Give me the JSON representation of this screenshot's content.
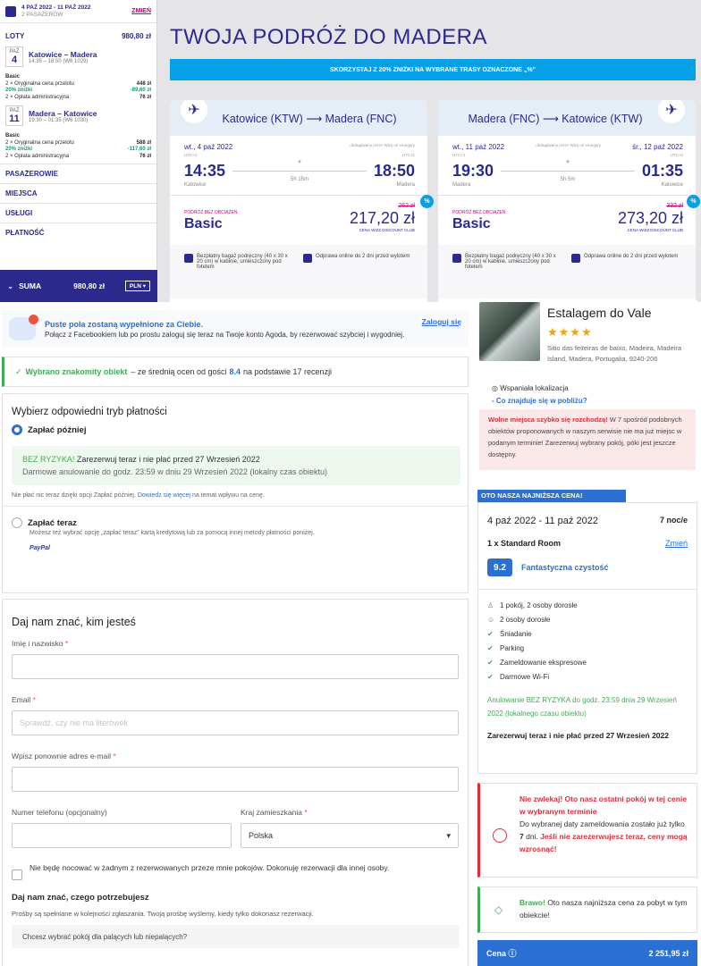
{
  "wizz": {
    "sidebar": {
      "dates": "4 PAŹ 2022 - 11 PAŹ 2022",
      "passengers": "2 PASAŻERÓW",
      "change": "ZMIEŃ",
      "flights_label": "LOTY",
      "flights_total": "980,80 zł",
      "flight1": {
        "month": "PAŹ",
        "day": "4",
        "route": "Katowice – Madera",
        "time": "14:35 – 18:50 (W6 1029)"
      },
      "fare1": {
        "name": "Basic",
        "l1": "2 × Oryginalna cena przelotu",
        "v1": "448 zł",
        "l2": "20% zniżki",
        "v2": "-89,60 zł",
        "l3": "2 × Opłata administracyjna",
        "v3": "76 zł"
      },
      "flight2": {
        "month": "PAŹ",
        "day": "11",
        "route": "Madera – Katowice",
        "time": "19:30 – 01:35 (W6 1030)"
      },
      "fare2": {
        "name": "Basic",
        "l1": "2 × Oryginalna cena przelotu",
        "v1": "588 zł",
        "l2": "20% zniżki",
        "v2": "-117,60 zł",
        "l3": "2 × Opłata administracyjna",
        "v3": "76 zł"
      },
      "sections": [
        "PASAŻEROWIE",
        "MIEJSCA",
        "USŁUGI",
        "PŁATNOŚĆ"
      ],
      "suma_label": "SUMA",
      "suma_value": "980,80 zł",
      "currency": "PLN"
    },
    "title": "TWOJA PODRÓŻ DO MADERA",
    "banner": "SKORZYSTAJ Z 20% ZNIŻKI NA WYBRANE TRASY OZNACZONE „%”",
    "out": {
      "route": "Katowice (KTW) ⟶ Madera (FNC)",
      "date": "wt., 4 paź 2022",
      "operator": "obsługiwany przez Wizz Air Hungary",
      "utc_dep": "UTC+2",
      "utc_arr": "UTC+1",
      "dep": "14:35",
      "arr": "18:50",
      "dur": "5h 15m",
      "from": "Katowice",
      "to": "Madera",
      "fare_label": "PODRÓŻ BEZ OBCIĄŻEŃ",
      "fare": "Basic",
      "old": "262 zł",
      "price": "217,20 zł",
      "club": "CENA WIZZ DISCOUNT CLUB",
      "f1": "Bezpłatny bagaż podręczny (40 x 30 x 20 cm) w kabinie, umieszczony pod fotelem",
      "f2": "Odprawa online do 2 dni przed wylotem"
    },
    "ret": {
      "route": "Madera (FNC) ⟶ Katowice (KTW)",
      "date": "wt., 11 paź 2022",
      "operator": "obsługiwany przez Wizz Air Hungary",
      "date2": "śr., 12 paź 2022",
      "utc_dep": "UTC+1",
      "utc_arr": "UTC+2",
      "dep": "19:30",
      "arr": "01:35",
      "dur": "5h 5m",
      "from": "Madera",
      "to": "Katowice",
      "fare_label": "PODRÓŻ BEZ OBCIĄŻEŃ",
      "fare": "Basic",
      "old": "332 zł",
      "price": "273,20 zł",
      "club": "CENA WIZZ DISCOUNT CLUB",
      "f1": "Bezpłatny bagaż podręczny (40 x 30 x 20 cm) w kabinie, umieszczony pod fotelem",
      "f2": "Odprawa online do 2 dni przed wylotem"
    },
    "pct": "%"
  },
  "agoda": {
    "fb": {
      "title": "Puste pola zostaną wypełnione za Ciebie.",
      "sub": "Połącz z Facebookiem lub po prostu zaloguj się teraz na Twoje konto Agoda, by rezerwować szybciej i wygodniej.",
      "login": "Zaloguj się"
    },
    "ok": {
      "pre": "✓",
      "bold": "Wybrano znakomity obiekt",
      "mid": "– ze średnią ocen od gości",
      "score": "8.4",
      "post": "na podstawie 17 recenzji"
    },
    "pay": {
      "title": "Wybierz odpowiedni tryb płatności",
      "later": "Zapłać później",
      "br1g": "BEZ RYZYKA!",
      "br1": "Zarezerwuj teraz i nie płać przed 27 Wrzesień 2022",
      "br2": "Darmowe anulowanie do godz. 23:59 w dniu 29 Wrzesień 2022 (lokalny czas obiektu)",
      "note1": "Nie płać nic teraz dzięki opcji Zapłać później.",
      "note_link": "Dowiedz się więcej",
      "note2": "na temat wpływu na cenę.",
      "now": "Zapłać teraz",
      "now_sub": "Możesz też wybrać opcję „zapłać teraz” kartą kredytową lub za pomocą innej metody płatności poniżej.",
      "paypal": "PayPal"
    },
    "who": {
      "title": "Daj nam znać, kim jesteś",
      "name": "Imię i nazwisko",
      "email": "Email",
      "email_ph": "Sprawdź, czy nie ma literówek",
      "email2": "Wpisz ponownie adres e-mail",
      "phone": "Numer telefonu (opcjonalny)",
      "country": "Kraj zamieszkania",
      "country_val": "Polska",
      "req": "*",
      "notstay": "Nie będę nocować w żadnym z rezerwowanych przeze mnie pokojów. Dokonuję rezerwacji dla innej osoby.",
      "needs_title": "Daj nam znać, czego potrzebujesz",
      "needs_sub": "Prośby są spełniane w kolejności zgłaszania. Twoją prośbę wyślemy, kiedy tylko dokonasz rezerwacji.",
      "smoking": "Chcesz wybrać pokój dla palących lub niepalących?"
    },
    "hotel": {
      "name": "Estalagem do Vale",
      "stars": "★★★★",
      "addr": "Sitio das feiteiras de baixo, Madeira, Madeira Island, Madera, Portugalia, 9240-206",
      "loc": "Wspaniała lokalizacja",
      "loc2": "- Co znajduje się w pobliżu?",
      "red_b": "Wolne miejsca szybko się rozchodzą!",
      "red": "W 7 spośród podobnych obiektów proponowanych w naszym serwisie nie ma już miejsc w podanym terminie! Zarezerwuj wybrany pokój, póki jest jeszcze dostępny."
    },
    "sum": {
      "tag": "OTO NASZA NAJNIŻSZA CENA!",
      "dates": "4 paź 2022 - 11 paź 2022",
      "nights": "7 noc/e",
      "room": "1 x Standard Room",
      "change": "Zmień",
      "score": "9.2",
      "score_t": "Fantastyczna czystość",
      "f": [
        "1 pokój, 2 osoby dorosłe",
        "2 osoby dorosłe",
        "Śniadanie",
        "Parking",
        "Zameldowanie ekspresowe",
        "Darmowe Wi-Fi"
      ],
      "canc": "Anulowanie BEZ RYZYKA do godz. 23:59 dnia 29 Wrzesień 2022 (lokalnego czasu obiektu)",
      "nopay": "Zarezerwuj teraz i nie płać przed 27 Wrzesień 2022"
    },
    "warn": {
      "t": "Nie zwlekaj! Oto nasz ostatni pokój w tej cenie w wybranym terminie",
      "s1": "Do wybranej daty zameldowania zostało już tylko",
      "n": "7",
      "s2": "dni.",
      "b": "Jeśli nie zarezerwujesz teraz, ceny mogą wzrosnąć!"
    },
    "brav": {
      "b": "Brawo!",
      "t": "Oto nasza najniższa cena za pobyt w tym obiekcie!"
    },
    "price": {
      "label": "Cena ⓘ",
      "value": "2 251,95 zł"
    }
  }
}
